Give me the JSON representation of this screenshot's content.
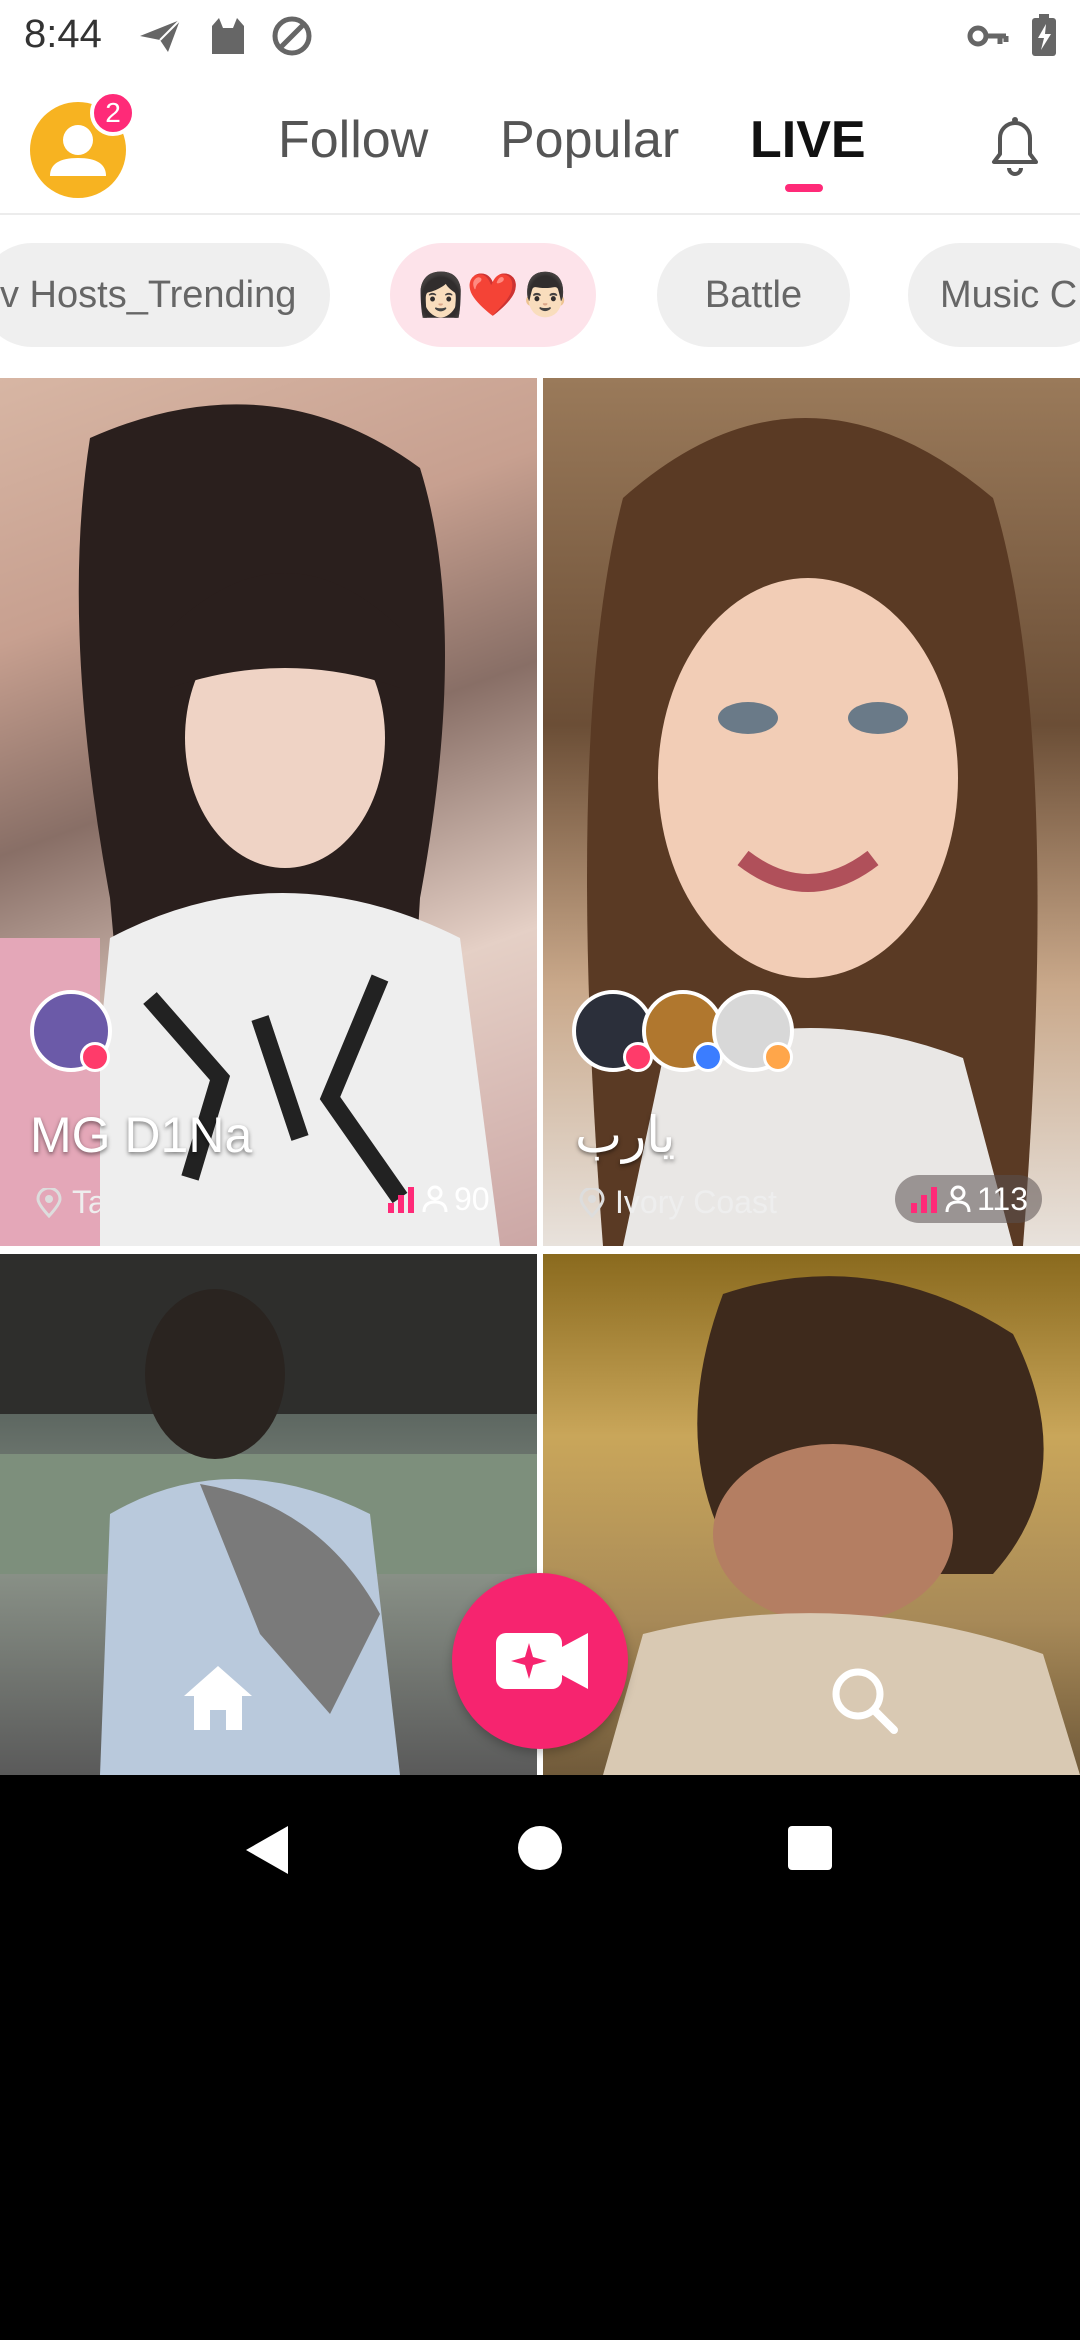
{
  "status_bar": {
    "time": "8:44"
  },
  "header": {
    "notification_count": "2",
    "tabs": [
      {
        "label": "Follow",
        "active": false
      },
      {
        "label": "Popular",
        "active": false
      },
      {
        "label": "LIVE",
        "active": true
      }
    ]
  },
  "chips": [
    {
      "label": "v Hosts_Trending"
    },
    {
      "label": "👩🏻❤️👨🏻",
      "selected": true
    },
    {
      "label": "Battle"
    },
    {
      "label": "Music C"
    }
  ],
  "cards": [
    {
      "name": "MG D1Na",
      "location": "Taiwan",
      "viewers": "90"
    },
    {
      "name": "يارب",
      "location": "Ivory Coast",
      "viewers": "113"
    },
    {
      "name": "",
      "location": "",
      "viewers": ""
    },
    {
      "name": "",
      "location": "",
      "viewers": ""
    }
  ],
  "colors": {
    "accent": "#ff2a78",
    "fab": "#f6246f",
    "avatar": "#f7b321"
  },
  "icons": {
    "status": [
      "send-icon",
      "cat-icon",
      "at-sign-icon",
      "key-icon",
      "battery-charging-icon"
    ],
    "nav": [
      "home-icon",
      "live-camera-icon",
      "search-icon"
    ],
    "system": [
      "back-icon",
      "home-circle-icon",
      "recents-icon"
    ]
  }
}
